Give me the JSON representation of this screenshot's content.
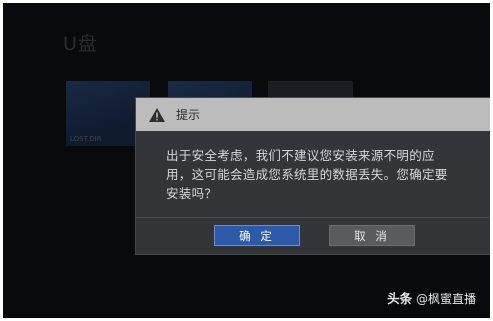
{
  "background": {
    "title": "U盘",
    "tile_label": "LOST.DIR"
  },
  "dialog": {
    "title": "提示",
    "title_icon": "warning-triangle-icon",
    "message": "出于安全考虑，我们不建议您安装来源不明的应用，这可能会造成您系统里的数据丢失。您确定要安装吗？",
    "confirm_label": "确 定",
    "cancel_label": "取 消"
  },
  "watermark": {
    "brand": "头条",
    "handle": "@枫蜜直播"
  },
  "colors": {
    "accent": "#2d5aa8",
    "screen_bg": "#090a0c",
    "dialog_bg": "#343539",
    "header_bg": "#bcbcbc"
  }
}
